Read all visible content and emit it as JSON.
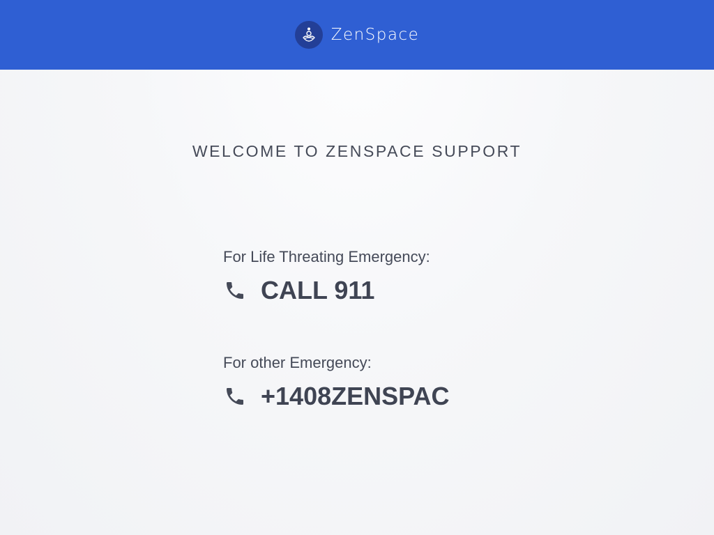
{
  "header": {
    "brand_name": "ZenSpace",
    "logo_icon": "zenspace-logo-icon",
    "background_color": "#2f5fd3"
  },
  "main": {
    "welcome_text": "WELCOME TO ZENSPACE SUPPORT",
    "contacts": [
      {
        "label": "For Life Threating Emergency:",
        "icon": "phone-icon",
        "value": "CALL 911"
      },
      {
        "label": "For other Emergency:",
        "icon": "phone-icon",
        "value": "+1408ZENSPAC"
      }
    ]
  },
  "colors": {
    "text_primary": "#454a58",
    "text_strong": "#3f4453"
  }
}
